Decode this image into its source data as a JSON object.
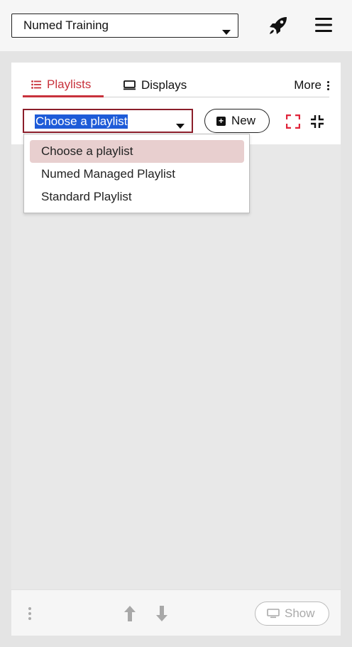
{
  "header": {
    "organization_select": {
      "value": "Numed Training"
    },
    "icons": {
      "rocket": "rocket-icon",
      "menu": "hamburger-menu-icon"
    }
  },
  "tabs": [
    {
      "label": "Playlists",
      "icon": "list-icon",
      "active": true
    },
    {
      "label": "Displays",
      "icon": "monitor-icon",
      "active": false
    }
  ],
  "more": {
    "label": "More",
    "icon": "vertical-dots-icon"
  },
  "playlist_select": {
    "value": "Choose a playlist",
    "options": [
      "Choose a playlist",
      "Numed Managed Playlist",
      "Standard Playlist"
    ]
  },
  "new_button": {
    "label": "New",
    "icon": "plus-square-icon"
  },
  "view_icons": {
    "expand": "expand-icon",
    "compress": "compress-icon"
  },
  "footer": {
    "show_button": {
      "label": "Show",
      "icon": "monitor-icon"
    },
    "icons": {
      "options": "vertical-dots-icon",
      "up": "arrow-up-icon",
      "down": "arrow-down-icon"
    }
  },
  "colors": {
    "accent": "#c8323c",
    "select_border": "#8b1e2a",
    "text_selection": "#1e5bd8",
    "option_highlight": "#e8cfcf"
  }
}
